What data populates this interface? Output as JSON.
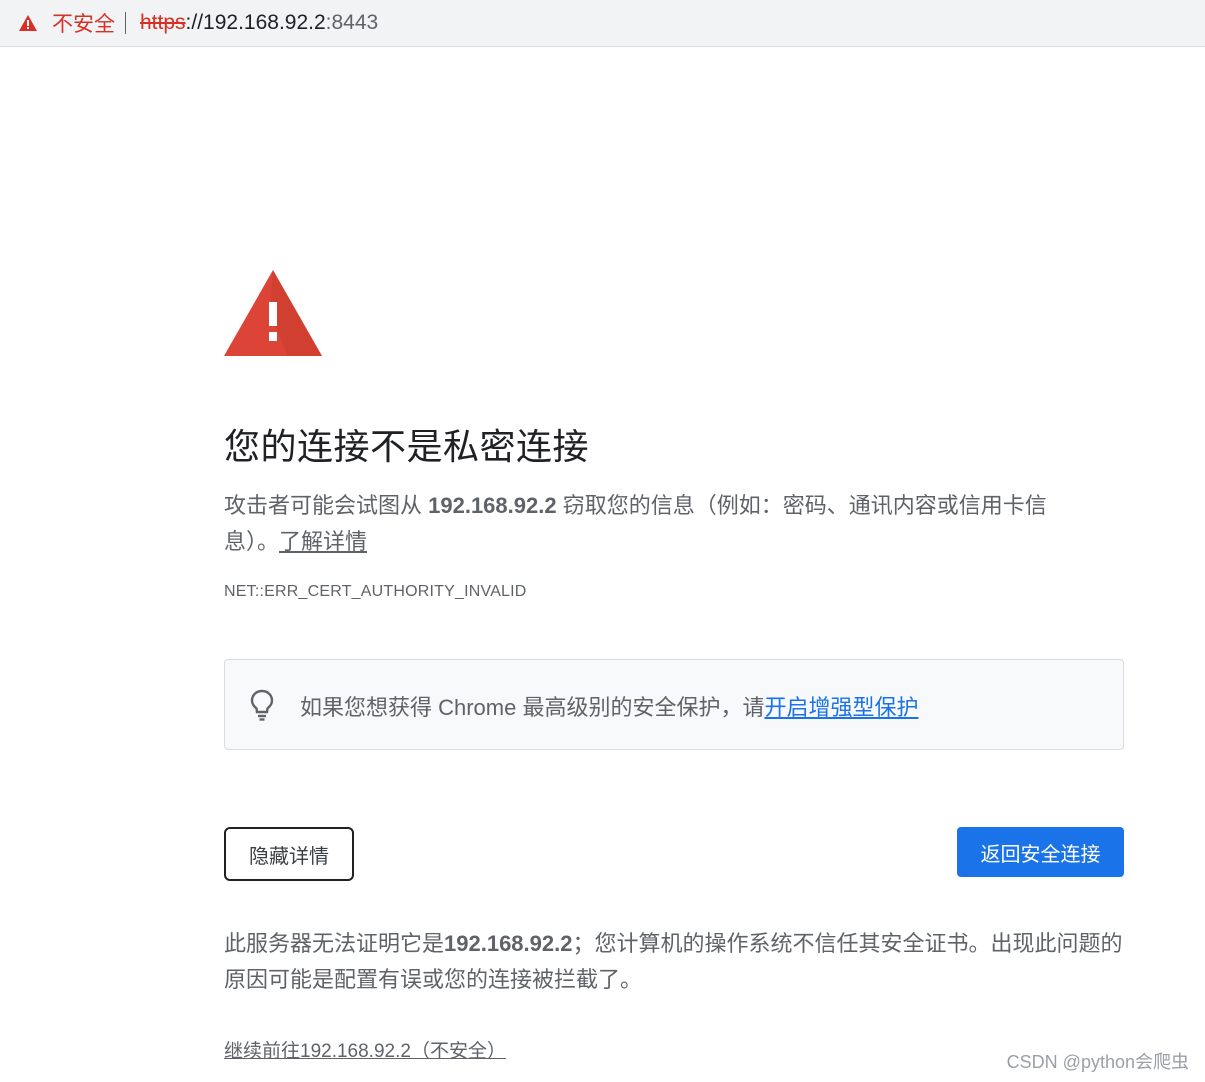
{
  "addressbar": {
    "security_label": "不安全",
    "scheme": "https",
    "separator": "://",
    "host": "192.168.92.2",
    "port": ":8443"
  },
  "interstitial": {
    "heading": "您的连接不是私密连接",
    "explain_prefix": "攻击者可能会试图从 ",
    "explain_host": "192.168.92.2",
    "explain_suffix": " 窃取您的信息（例如：密码、通讯内容或信用卡信息）。",
    "learn_more": "了解详情",
    "error_code": "NET::ERR_CERT_AUTHORITY_INVALID",
    "promo_text": "如果您想获得 Chrome 最高级别的安全保护，请",
    "promo_link": "开启增强型保护",
    "hide_details_button": "隐藏详情",
    "back_button": "返回安全连接",
    "details_prefix": "此服务器无法证明它是",
    "details_host": "192.168.92.2",
    "details_suffix": "；您计算机的操作系统不信任其安全证书。出现此问题的原因可能是配置有误或您的连接被拦截了。",
    "proceed_link": "继续前往192.168.92.2（不安全）"
  },
  "watermark": "CSDN @python会爬虫",
  "colors": {
    "warning_red": "#d93025",
    "primary_blue": "#1a73e8",
    "text_gray": "#5f6368"
  },
  "icons": [
    "warning-triangle-icon",
    "lightbulb-icon"
  ]
}
